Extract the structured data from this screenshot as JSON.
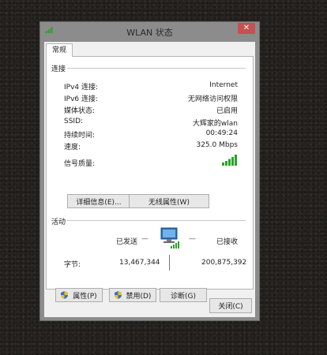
{
  "window": {
    "title": "WLAN 状态",
    "close_glyph": "✕"
  },
  "tabs": [
    {
      "label": "常规"
    }
  ],
  "connection": {
    "section_label": "连接",
    "rows": [
      {
        "label": "IPv4 连接:",
        "value": "Internet"
      },
      {
        "label": "IPv6 连接:",
        "value": "无网络访问权限"
      },
      {
        "label": "媒体状态:",
        "value": "已启用"
      },
      {
        "label": "SSID:",
        "value": "大辉家的wlan"
      },
      {
        "label": "持续时间:",
        "value": "00:49:24"
      },
      {
        "label": "速度:",
        "value": "325.0 Mbps"
      }
    ],
    "signal_label": "信号质量:",
    "signal_bars": 5,
    "details_button": "详细信息(E)...",
    "wireless_props_button": "无线属性(W)"
  },
  "activity": {
    "section_label": "活动",
    "sent_label": "已发送",
    "received_label": "已接收",
    "bytes_label": "字节:",
    "bytes_sent": "13,467,344",
    "bytes_received": "200,875,392"
  },
  "buttons": {
    "properties": "属性(P)",
    "disable": "禁用(D)",
    "diagnose": "诊断(G)",
    "close": "关闭(C)"
  },
  "colors": {
    "signal_green": "#27a327",
    "close_red": "#c75050",
    "shield_blue": "#3a6fc4",
    "shield_yellow": "#e8c22c"
  }
}
